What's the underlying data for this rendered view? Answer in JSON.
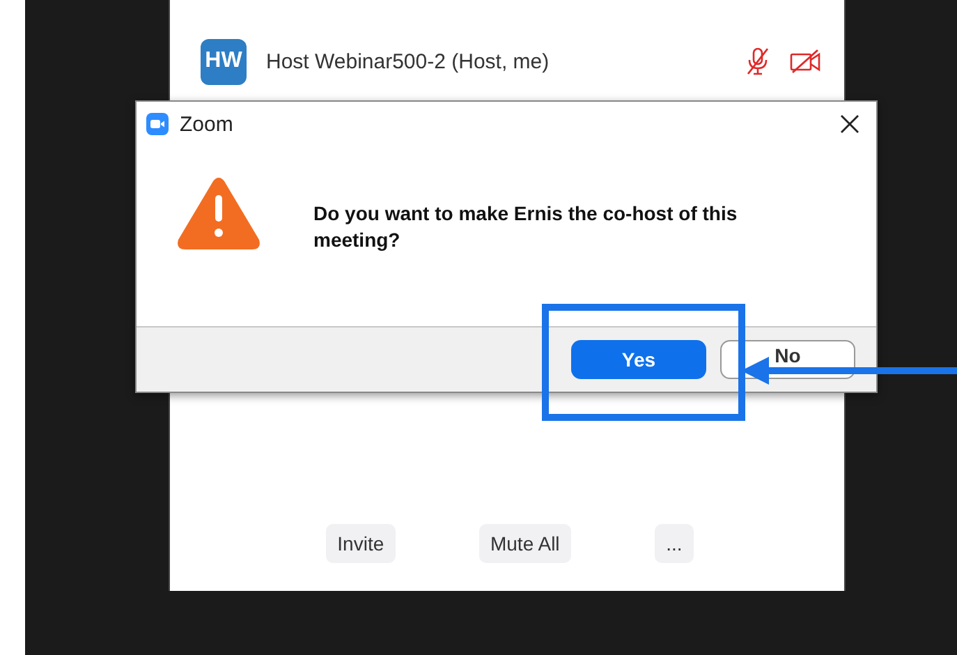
{
  "panel": {
    "participants": [
      {
        "initials": "HW",
        "name": "Host Webinar500-2 (Host, me)",
        "audio_muted": true,
        "video_off": true
      }
    ],
    "buttons": [
      "Invite",
      "Mute All",
      "..."
    ]
  },
  "dialog": {
    "title": "Zoom",
    "message": "Do you want to make Ernis the co-host of this meeting?",
    "buttons": [
      {
        "label": "Yes",
        "kind": "primary"
      },
      {
        "label": "No",
        "kind": "secondary"
      }
    ]
  },
  "annotations": {
    "highlight_box": true,
    "pointer_arrow": true
  }
}
